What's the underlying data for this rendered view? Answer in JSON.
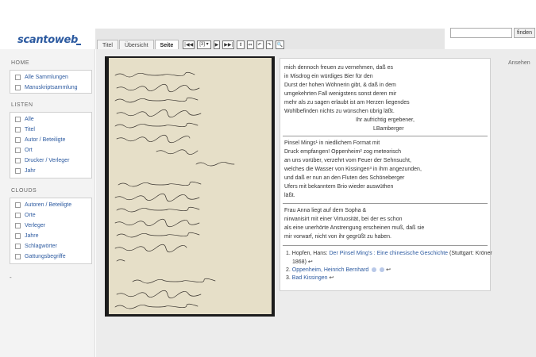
{
  "header": {
    "logo_scan": "scan",
    "logo_to": "to",
    "logo_web": "web",
    "search_placeholder": "",
    "search_button": "finden"
  },
  "tabs": [
    {
      "label": "Titel",
      "active": false
    },
    {
      "label": "Übersicht",
      "active": false
    },
    {
      "label": "Seite",
      "active": true
    }
  ],
  "toolbar": {
    "first": "|◀◀",
    "prev": "◀",
    "page_select": "[3] ▾",
    "next": "▶",
    "last": "▶▶|",
    "zoom_fit": "⇕",
    "zoom_width": "⇔",
    "rotate_left": "↶",
    "rotate_right": "↷",
    "zoom": "🔍"
  },
  "sidebar": {
    "home_heading": "HOME",
    "home_items": [
      "Alle Sammlungen",
      "Manuskriptsammlung"
    ],
    "listen_heading": "LISTEN",
    "listen_items": [
      "Alle",
      "Titel",
      "Autor / Beteiligte",
      "Ort",
      "Drucker / Verleger",
      "Jahr"
    ],
    "clouds_heading": "CLOUDS",
    "clouds_items": [
      "Autoren / Beteiligte",
      "Orte",
      "Verleger",
      "Jahre",
      "Schlagwörter",
      "Gattungsbegriffe"
    ],
    "dash": "-"
  },
  "transcript": {
    "para1": [
      "mich dennoch freuen zu vernehmen, daß es",
      "in Misdrog ein würdiges Bier für den",
      "Durst der hohen Wöhnerin gibt, & daß in dem",
      "umgekehrten Fall wenigstens sonst deren mir",
      "mehr als zu sagen erlaubt ist am Herzen liegendes",
      "Wohlbefinden nichts zu wünschen übrig läßt."
    ],
    "closing": "Ihr aufrichtig ergebener,",
    "signature": "LBamberger",
    "para2": [
      "Pinsel Mings¹ in niedlichem Format mit",
      "Druck empfangen! Oppenheim² zog meteorisch",
      "an uns vorüber, verzehrt vom Feuer der Sehnsucht,",
      "welches die Wasser von Kissingen³ in ihm angezunden,",
      "und daß er nun an den Fluten des Schöneberger",
      "Ufers mit bekanntem Brio wieder auswüthen",
      "läßt."
    ],
    "para3": [
      "Frau Anna liegt auf dem Sopha &",
      "nirwanisirt mit einer Virtuosität, bei der es schon",
      "als eine unerhörte Anstrengung erscheinen muß, daß sie",
      "mir vorwarf, nicht von ihr gegrüßt zu haben."
    ],
    "footnotes": {
      "fn1_num": "1.",
      "fn1_author": "Hopfen, Hans:",
      "fn1_link": "Der Pinsel Ming's : Eine chinesische Geschichte",
      "fn1_pub": "(Stuttgart: Kröner",
      "fn1_year": "1868) ↩",
      "fn2_num": "2.",
      "fn2_link": "Oppenheim, Heinrich Bernhard",
      "fn2_back": "↩",
      "fn3_num": "3.",
      "fn3_link": "Bad Kissingen",
      "fn3_back": "↩"
    }
  },
  "right_panel": {
    "ansehen": "Ansehen"
  },
  "colors": {
    "brand": "#2c5aa0",
    "sidebar_bg": "#f3f3f3",
    "paper": "#e6dfc8"
  }
}
